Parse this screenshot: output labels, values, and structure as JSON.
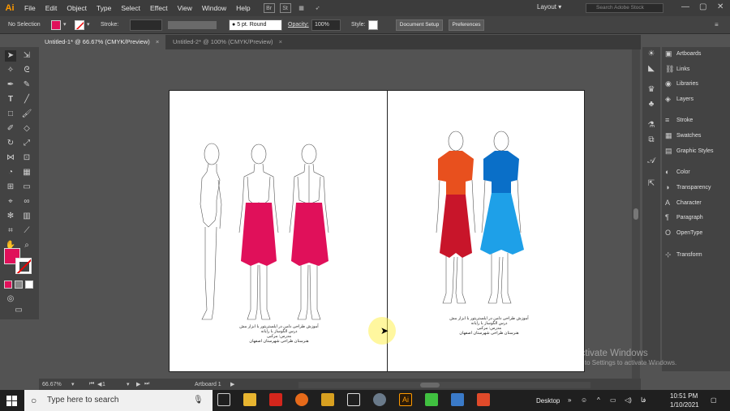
{
  "app": {
    "logo": "Ai"
  },
  "menu": [
    "File",
    "Edit",
    "Object",
    "Type",
    "Select",
    "Effect",
    "View",
    "Window",
    "Help"
  ],
  "bridge_buttons": [
    "Br",
    "St"
  ],
  "workspace": "Layout ▾",
  "stock_search": {
    "placeholder": "Search Adobe Stock"
  },
  "control": {
    "selection": "No Selection",
    "stroke_label": "Stroke:",
    "brush": "5 pt. Round",
    "opacity_label": "Opacity:",
    "opacity_value": "100%",
    "style_label": "Style:",
    "doc_setup": "Document Setup",
    "preferences": "Preferences"
  },
  "tabs": [
    {
      "label": "Untitled-1* @ 66.67% (CMYK/Preview)"
    },
    {
      "label": "Untitled-2* @ 100% (CMYK/Preview)"
    }
  ],
  "artboard_text_left": [
    "آموزش طراحی دامن در ایلستریتور با ابزار مش",
    "درس الگوساز با رایانه",
    "مدرس: مرکبی",
    "هنرستان طراحی شهرستان اصفهان"
  ],
  "artboard_text_right": [
    "آموزش طراحی دامن در ایلستریتور با ابزار مش",
    "درس الگوساز با رایانه",
    "مدرس: مرکبی",
    "هنرستان طراحی شهرستان اصفهان"
  ],
  "panels": [
    {
      "label": "Artboards",
      "icon": "artboards-icon"
    },
    {
      "label": "Links",
      "icon": "links-icon"
    },
    {
      "label": "Libraries",
      "icon": "libraries-icon"
    },
    {
      "label": "Layers",
      "icon": "layers-icon"
    },
    {
      "label": "Stroke",
      "icon": "stroke-icon"
    },
    {
      "label": "Swatches",
      "icon": "swatches-icon"
    },
    {
      "label": "Graphic Styles",
      "icon": "graphic-styles-icon"
    },
    {
      "label": "Color",
      "icon": "color-icon"
    },
    {
      "label": "Transparency",
      "icon": "transparency-icon"
    },
    {
      "label": "Character",
      "icon": "character-icon"
    },
    {
      "label": "Paragraph",
      "icon": "paragraph-icon"
    },
    {
      "label": "OpenType",
      "icon": "opentype-icon"
    },
    {
      "label": "Transform",
      "icon": "transform-icon"
    }
  ],
  "status": {
    "zoom": "66.67%",
    "artboard_num": "1",
    "artboard_name": "Artboard 1"
  },
  "watermark": {
    "line1": "Activate Windows",
    "line2": "Go to Settings to activate Windows."
  },
  "taskbar": {
    "search_placeholder": "Type here to search",
    "desktop_label": "Desktop",
    "lang": "فا",
    "time": "10:51 PM",
    "date": "1/10/2021"
  },
  "colors": {
    "fill": "#e0105a",
    "skirt_magenta": "#e0105a",
    "orange_top": "#e8501e",
    "red_skirt": "#c8152a",
    "blue_top": "#0a6fc8",
    "blue_skirt": "#1ea0e8"
  }
}
